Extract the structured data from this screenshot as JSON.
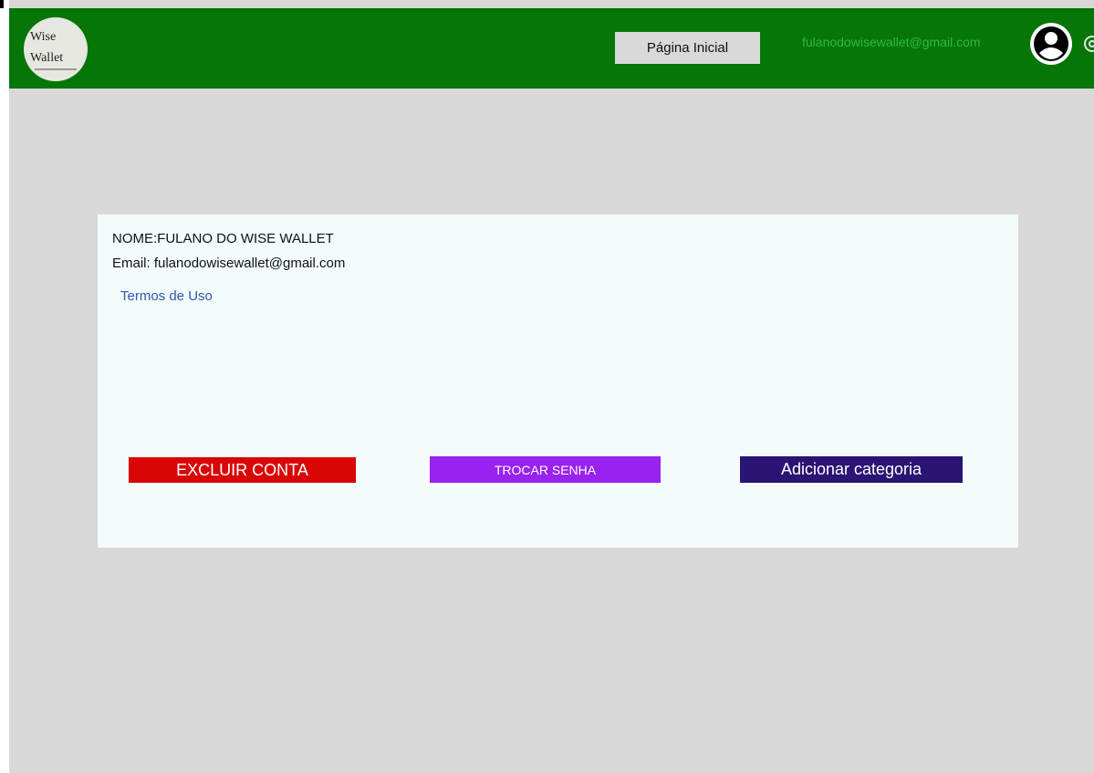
{
  "colors": {
    "header_bg": "#057607",
    "page_bg": "#d8d8d8",
    "card_bg": "#f3fbfd",
    "delete_button": "#d90606",
    "password_button": "#9a22ee",
    "category_button": "#2a1474",
    "link": "#2d59a8",
    "header_email": "#33b940"
  },
  "header": {
    "logo": {
      "line1": "Wise",
      "line2": "Wallet"
    },
    "nav_home_label": "Página Inicial",
    "user_email": "fulanodowisewallet@gmail.com",
    "avatar_icon": "user-circle-icon",
    "settings_icon": "gear-icon"
  },
  "profile": {
    "name_line": "NOME:FULANO DO WISE WALLET",
    "email_line": "Email: fulanodowisewallet@gmail.com",
    "terms_link": "Termos de Uso"
  },
  "actions": {
    "delete_account": "EXCLUIR CONTA",
    "change_password": "TROCAR SENHA",
    "add_category": "Adicionar categoria"
  }
}
